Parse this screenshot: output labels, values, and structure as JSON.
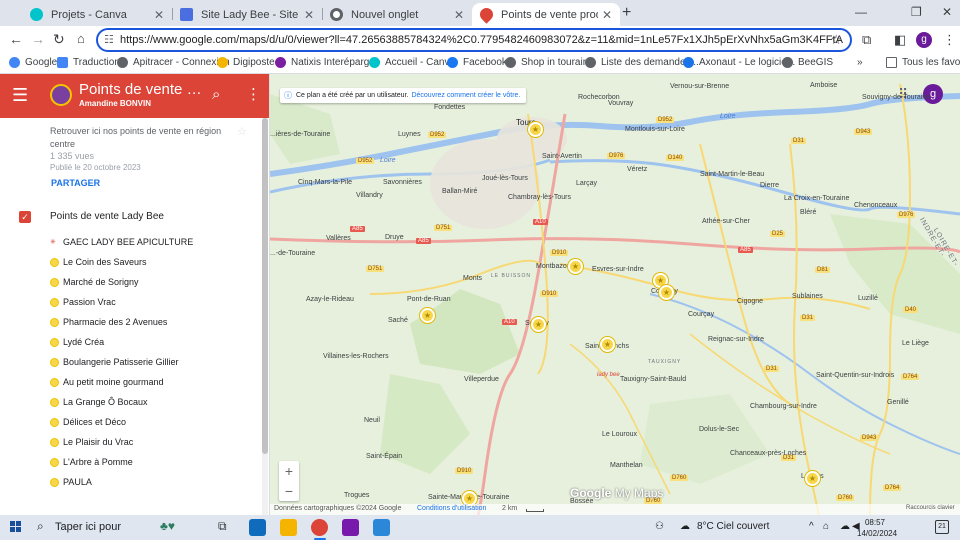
{
  "browser": {
    "tabs": [
      {
        "title": "Projets - Canva",
        "icon": "canva-icon",
        "active": false
      },
      {
        "title": "Site Lady Bee - Site Web",
        "icon": "site-icon",
        "active": false
      },
      {
        "title": "Nouvel onglet",
        "icon": "chrome-icon",
        "active": false
      },
      {
        "title": "Points de vente produits Lady B",
        "icon": "mymaps-icon",
        "active": true
      }
    ],
    "new_tab": "+",
    "url": "https://www.google.com/maps/d/u/0/viewer?ll=47.26563885784324%2C0.7795482460983072&z=11&mid=1nLe57Fx1XJh5pErXvNhx5aGm3K4FFtA",
    "profile_initial": "g",
    "bookmarks": [
      {
        "label": "Google",
        "color": "#4285f4"
      },
      {
        "label": "Traduction",
        "color": "#4285f4"
      },
      {
        "label": "Apitracer - Connexion",
        "color": "#5f6368"
      },
      {
        "label": "Digiposte",
        "color": "#f4b400"
      },
      {
        "label": "Natixis Interépargne",
        "color": "#7b1fa2"
      },
      {
        "label": "Accueil - Canva",
        "color": "#00c4cc"
      },
      {
        "label": "Facebook",
        "color": "#1877f2"
      },
      {
        "label": "Shop in touraine",
        "color": "#5f6368"
      },
      {
        "label": "Liste des demandes...",
        "color": "#5f6368"
      },
      {
        "label": "Axonaut - Le logicie...",
        "color": "#1a73e8"
      },
      {
        "label": "BeeGIS",
        "color": "#5f6368"
      }
    ],
    "bookmarks_more": "»",
    "all_favorites": "Tous les favoris"
  },
  "sidebar": {
    "title": "Points de vente produi...",
    "owner": "Amandine BONVIN",
    "description": "Retrouver ici nos points de vente en région centre",
    "views": "1 335 vues",
    "published": "Publié le 20 octobre 2023",
    "share": "PARTAGER",
    "layer": "Points de vente Lady Bee",
    "places": [
      {
        "name": "GAEC LADY BEE APICULTURE",
        "marker": "logo"
      },
      {
        "name": "Le Coin des Saveurs",
        "marker": "dot"
      },
      {
        "name": "Marché de Sorigny",
        "marker": "dot"
      },
      {
        "name": "Passion Vrac",
        "marker": "dot"
      },
      {
        "name": "Pharmacie des 2 Avenues",
        "marker": "dot"
      },
      {
        "name": "Lydé Créa",
        "marker": "dot"
      },
      {
        "name": "Boulangerie Patisserie Gillier",
        "marker": "dot"
      },
      {
        "name": "Au petit moine gourmand",
        "marker": "dot"
      },
      {
        "name": "La Grange Ô Bocaux",
        "marker": "dot"
      },
      {
        "name": "Délices et Déco",
        "marker": "dot"
      },
      {
        "name": "Le Plaisir du Vrac",
        "marker": "dot"
      },
      {
        "name": "L'Arbre à Pomme",
        "marker": "dot"
      },
      {
        "name": "PAULA",
        "marker": "dot"
      }
    ]
  },
  "map": {
    "notice": "Ce plan a été créé par un utilisateur.",
    "notice_link": "Découvrez comment créer le vôtre.",
    "user_initial": "g",
    "zoom_in": "+",
    "zoom_out": "−",
    "logo_google": "Google",
    "logo_mymaps": "My Maps",
    "attribution": "Données cartographiques ©2024 Google",
    "terms": "Conditions d'utilisation",
    "scale": "2 km",
    "shortcuts": "Raccourcis clavier",
    "places": {
      "fondettes": "Fondettes",
      "rochecorbon": "Rochecorbon",
      "vernou": "Vernou-sur-Brenne",
      "amboise": "Amboise",
      "souvigny": "Souvigny-de-Touraine",
      "tours": "Tours",
      "vouvray": "Vouvray",
      "montlouis": "Montlouis-sur-Loire",
      "luynes": "Luynes",
      "sainte_avertin": "Saint-Avertin",
      "saint_martin": "Saint-Martin-le-Beau",
      "cinq_mars": "Cinq-Mars-la-Pile",
      "savonnieres": "Savonnières",
      "joue": "Joué-lès-Tours",
      "dierre": "Dierre",
      "ballan": "Ballan-Miré",
      "larcay": "Larçay",
      "veretz": "Véretz",
      "villandry": "Villandry",
      "chambray": "Chambray-lès-Tours",
      "croix": "La Croix-en-Touraine",
      "chenonceaux": "Chenonceaux",
      "athee": "Athée-sur-Cher",
      "blere": "Bléré",
      "langeais": "...ières-de-Touraine",
      "valleres": "Vallères",
      "druye": "Druye",
      "montbazon": "Montbazon",
      "esvres": "Esvres-sur-Indre",
      "le_buisson": "LE BUISSON",
      "monts": "Monts",
      "saint_cyr": "...-de-Touraine",
      "cormery": "Cormery",
      "azay": "Azay-le-Rideau",
      "pont_de_ruan": "Pont-de-Ruan",
      "cigogne": "Cigogne",
      "sublaines": "Sublaines",
      "luzille": "Luzillé",
      "sache": "Saché",
      "sorigny": "Sorigny",
      "courcay": "Courçay",
      "saint_branchs": "Saint-Branchs",
      "reignac": "Reignac-sur-Indre",
      "le_liege": "Le Liège",
      "tauxigny": "TAUXIGNY",
      "tauxigny_bauld": "Tauxigny-Saint-Bauld",
      "villaines": "Villaines-les-Rochers",
      "villeperdue": "Villeperdue",
      "saint_quentin": "Saint-Quentin-sur-Indrois",
      "genille": "Genillé",
      "chambourg": "Chambourg-sur-Indre",
      "neuil": "Neuil",
      "louroux": "Le Louroux",
      "dolus": "Dolus-le-Sec",
      "saint_epain": "Saint-Épain",
      "manthelan": "Manthelan",
      "chanceaux": "Chanceaux-près-Loches",
      "loches": "Loches",
      "sainte_maure": "Sainte-Maure-de-Touraine",
      "trogues": "Trogues",
      "bossee": "Bossée",
      "loire_river": "Loire",
      "cher_river": "Loire",
      "ladybee_mark": "lady bee",
      "dept1": "INDRE-ET-",
      "dept2": "LOIRE-ET-"
    },
    "road_labels": {
      "d952a": "D952",
      "d952b": "D952",
      "d952c": "D952",
      "d751": "D751",
      "d976a": "D976",
      "d976b": "D976",
      "d140": "D140",
      "d31a": "D31",
      "d31b": "D31",
      "d31c": "D31",
      "d31d": "D31",
      "d910a": "D910",
      "d910b": "D910",
      "d910c": "D910",
      "a85a": "A85",
      "a85b": "A85",
      "a85c": "A85",
      "a10a": "A10",
      "a10b": "A10",
      "d943a": "D943",
      "d943b": "D943",
      "d764a": "D764",
      "d764b": "D764",
      "d760a": "D760",
      "d760b": "D760",
      "d760c": "D760",
      "d25": "D25",
      "d81": "D81",
      "d751b": "D751",
      "d40": "D40"
    }
  },
  "taskbar": {
    "search": "Taper ici pour",
    "weather": "8°C  Ciel couvert",
    "time": "08:57",
    "date": "14/02/2024",
    "notifications": "21"
  },
  "colors": {
    "header": "#db4437",
    "pin": "#f7d64a",
    "accent": "#1a73e8"
  }
}
